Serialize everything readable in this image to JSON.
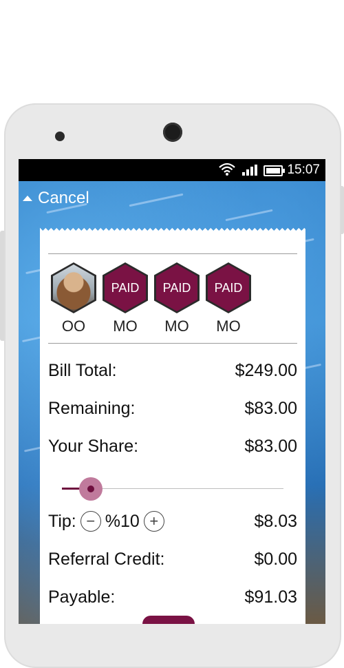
{
  "status_bar": {
    "time": "15:07"
  },
  "nav": {
    "cancel_label": "Cancel"
  },
  "avatars": [
    {
      "initials": "OO",
      "badge": ""
    },
    {
      "initials": "MO",
      "badge": "PAID"
    },
    {
      "initials": "MO",
      "badge": "PAID"
    },
    {
      "initials": "MO",
      "badge": "PAID"
    }
  ],
  "bill": {
    "total_label": "Bill Total:",
    "total_value": "$249.00",
    "remaining_label": "Remaining:",
    "remaining_value": "$83.00",
    "share_label": "Your Share:",
    "share_value": "$83.00",
    "share_slider_fraction": 0.13,
    "tip_label": "Tip:",
    "tip_minus": "−",
    "tip_percent": "%10",
    "tip_plus": "+",
    "tip_value": "$8.03",
    "referral_label": "Referral Credit:",
    "referral_value": "$0.00",
    "payable_label": "Payable:",
    "payable_value": "$91.03"
  },
  "colors": {
    "accent": "#7a1244",
    "accent_light": "#c07a9c"
  }
}
